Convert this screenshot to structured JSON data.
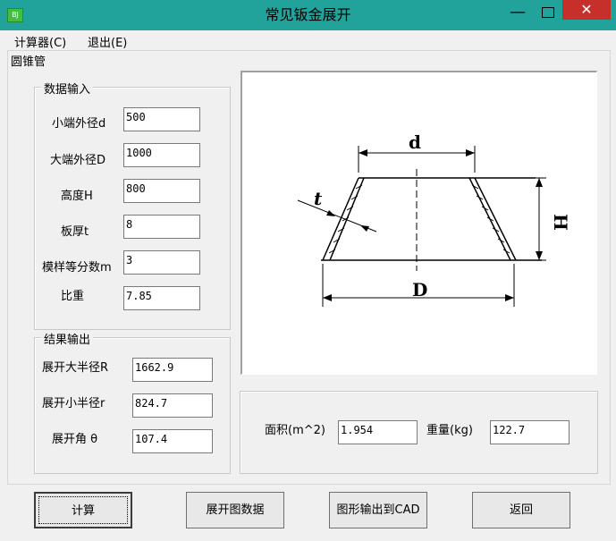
{
  "window": {
    "title": "常见钣金展开",
    "icon_text": "BJ",
    "minimize": "—",
    "close": "✕"
  },
  "menu": {
    "items": [
      "计算器(C)",
      "退出(E)"
    ]
  },
  "main_group": {
    "label": "圆锥管"
  },
  "input_group": {
    "label": "数据输入",
    "fields": [
      {
        "label": "小端外径d",
        "value": "500"
      },
      {
        "label": "大端外径D",
        "value": "1000"
      },
      {
        "label": "高度H",
        "value": "800"
      },
      {
        "label": "板厚t",
        "value": "8"
      },
      {
        "label": "模样等分数m",
        "value": "3"
      },
      {
        "label": "比重",
        "value": "7.85"
      }
    ]
  },
  "output_group": {
    "label": "结果输出",
    "fields": [
      {
        "label": "展开大半径R",
        "value": "1662.9"
      },
      {
        "label": "展开小半径r",
        "value": "824.7"
      },
      {
        "label": "展开角 θ",
        "value": "107.4"
      }
    ]
  },
  "summary": {
    "area_label": "面积(m^2)",
    "area_value": "1.954",
    "weight_label": "重量(kg)",
    "weight_value": "122.7"
  },
  "drawing": {
    "label_d": "d",
    "label_D": "D",
    "label_H": "H",
    "label_t": "t"
  },
  "buttons": {
    "calc": "计算",
    "unfold_data": "展开图数据",
    "export_cad": "图形输出到CAD",
    "back": "返回"
  }
}
